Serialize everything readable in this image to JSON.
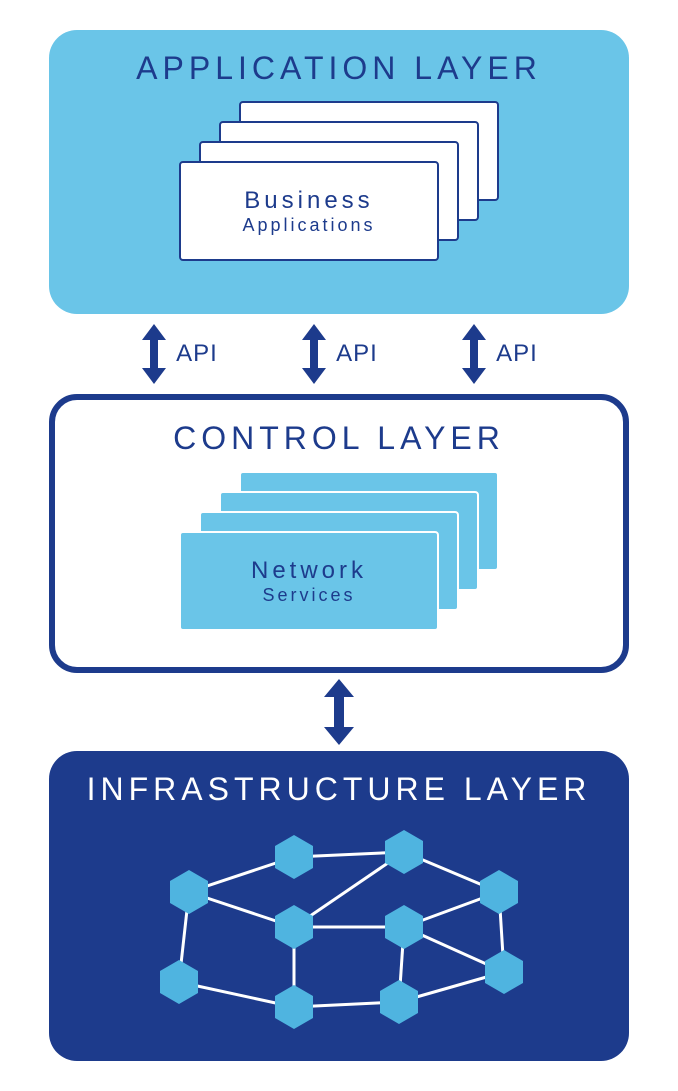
{
  "layers": {
    "application": {
      "title": "APPLICATION LAYER",
      "card_top": "Business",
      "card_bottom": "Applications"
    },
    "control": {
      "title": "CONTROL LAYER",
      "card_top": "Network",
      "card_bottom": "Services"
    },
    "infrastructure": {
      "title": "INFRASTRUCTURE LAYER"
    }
  },
  "api_label": "API",
  "colors": {
    "light_blue": "#6ac5e8",
    "dark_blue": "#1d3b8c",
    "white": "#ffffff"
  }
}
